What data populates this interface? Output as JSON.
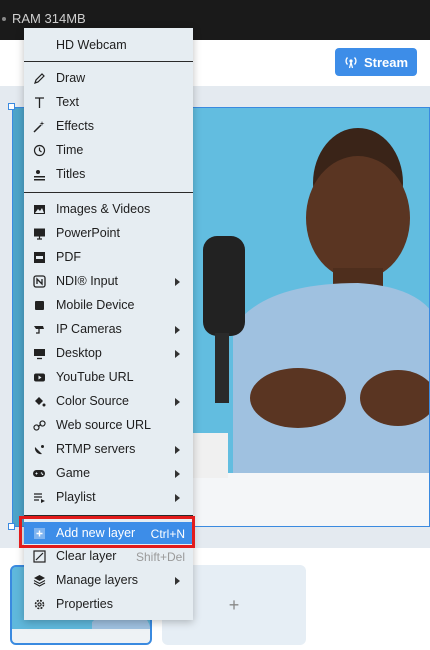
{
  "topbar": {
    "ram": "RAM 314MB"
  },
  "toolbar": {
    "stream_label": "Stream"
  },
  "menu": {
    "header": "HD Webcam",
    "group1": [
      "Draw",
      "Text",
      "Effects",
      "Time",
      "Titles"
    ],
    "group2": [
      "Images & Videos",
      "PowerPoint",
      "PDF",
      "NDI® Input",
      "Mobile Device",
      "IP Cameras",
      "Desktop",
      "YouTube URL",
      "Color Source",
      "Web source URL",
      "RTMP servers",
      "Game",
      "Playlist"
    ],
    "add_layer": {
      "label": "Add new layer",
      "shortcut": "Ctrl+N"
    },
    "clear_layer": {
      "label": "Clear layer",
      "shortcut": "Shift+Del"
    },
    "manage_layers": "Manage layers",
    "properties": "Properties"
  },
  "scenes": {
    "add_symbol": "+"
  },
  "colors": {
    "accent": "#3d8de8",
    "highlight_border": "#e31b1b"
  }
}
